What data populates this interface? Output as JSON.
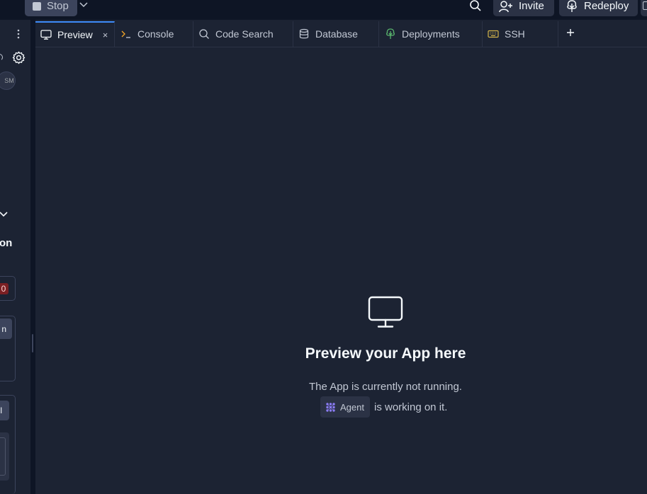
{
  "topbar": {
    "stop_label": "Stop",
    "invite_label": "Invite",
    "redeploy_label": "Redeploy"
  },
  "left_panel": {
    "avatar_initials": "SM",
    "heading_fragment": "on",
    "badge_value": "0",
    "button1_fragment": "n",
    "button2_fragment": "l"
  },
  "tabs": [
    {
      "label": "Preview",
      "icon": "monitor-icon",
      "active": true
    },
    {
      "label": "Console",
      "icon": "terminal-icon"
    },
    {
      "label": "Code Search",
      "icon": "search-icon"
    },
    {
      "label": "Database",
      "icon": "database-icon"
    },
    {
      "label": "Deployments",
      "icon": "deploy-icon"
    },
    {
      "label": "SSH",
      "icon": "keyboard-icon"
    }
  ],
  "tab_close_glyph": "×",
  "preview": {
    "title": "Preview your App here",
    "subtitle": "The App is currently not running.",
    "agent_label": "Agent",
    "agent_suffix": "is working on it."
  },
  "colors": {
    "background": "#1c2333",
    "topbar": "#0e1525",
    "accent_tab": "#3e8bf8",
    "deploy_green": "#58b26c",
    "agent_purple": "#8b7cf6"
  }
}
